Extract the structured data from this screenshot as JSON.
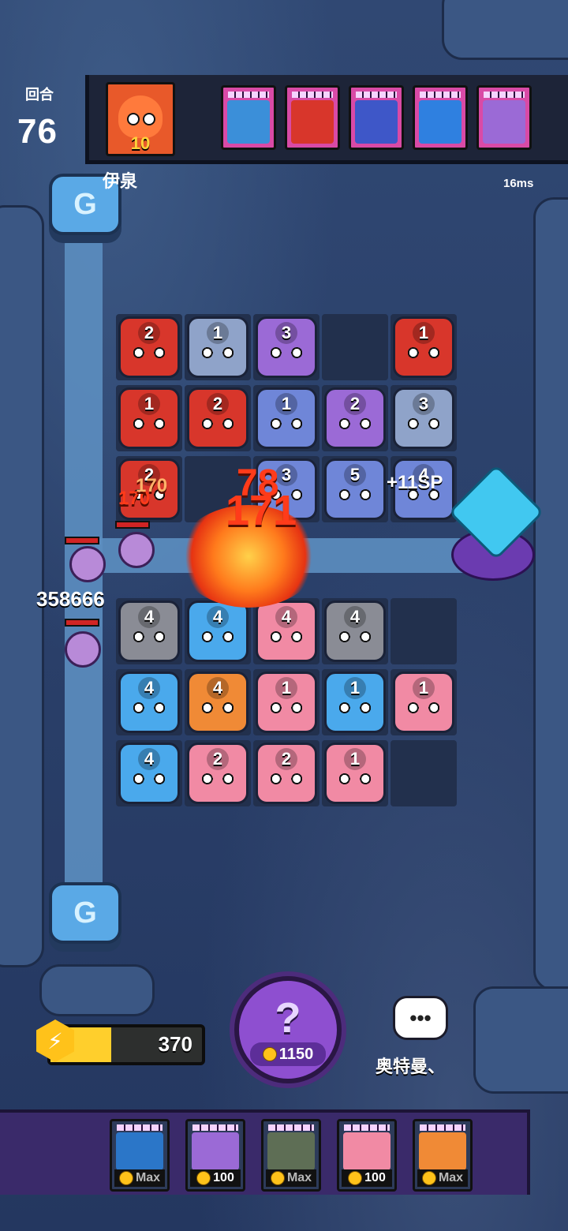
{
  "hud": {
    "round_label": "回合",
    "round_number": "76",
    "player_level": "10",
    "player_name": "伊泉",
    "ping": "16ms",
    "deck": [
      {
        "name": "ghost",
        "color": "#3b8fd9"
      },
      {
        "name": "red-demon",
        "color": "#d8362b"
      },
      {
        "name": "blue-jelly",
        "color": "#3e57c8"
      },
      {
        "name": "ice-wave",
        "color": "#2f80e0"
      },
      {
        "name": "mirror",
        "color": "#9b6ad6"
      }
    ]
  },
  "board": {
    "rows": [
      [
        "2",
        "1",
        "3",
        "",
        "1"
      ],
      [
        "1",
        "2",
        "1",
        "2",
        "3"
      ],
      [
        "2",
        "",
        "3",
        "5",
        "4"
      ],
      [
        "",
        "",
        "",
        "",
        ""
      ],
      [
        "4",
        "4",
        "4",
        "4",
        ""
      ],
      [
        "4",
        "4",
        "1",
        "1",
        "1"
      ],
      [
        "4",
        "2",
        "2",
        "1",
        ""
      ]
    ]
  },
  "effects": {
    "damage_a": "78",
    "damage_b": "171",
    "damage_small_a": "170",
    "damage_small_b": "170",
    "sp_gain": "+11SP",
    "enemy_hp": "358666"
  },
  "footer": {
    "sp_value": "370",
    "sp_fill_fraction": 0.4,
    "summon_symbol": "?",
    "summon_cost": "1150",
    "chat_symbol": "•••",
    "opponent_name": "奥特曼、",
    "upgrades": [
      {
        "name": "ice-cat",
        "label": "Max",
        "is_max": true,
        "color": "#2b76c8"
      },
      {
        "name": "mirror",
        "label": "100",
        "is_max": false,
        "color": "#9b6ad6"
      },
      {
        "name": "stone-golem",
        "label": "Max",
        "is_max": true,
        "color": "#5e6e55"
      },
      {
        "name": "pink-nurse",
        "label": "100",
        "is_max": false,
        "color": "#f18aa4"
      },
      {
        "name": "fire-lion",
        "label": "Max",
        "is_max": true,
        "color": "#f08a36"
      }
    ]
  }
}
